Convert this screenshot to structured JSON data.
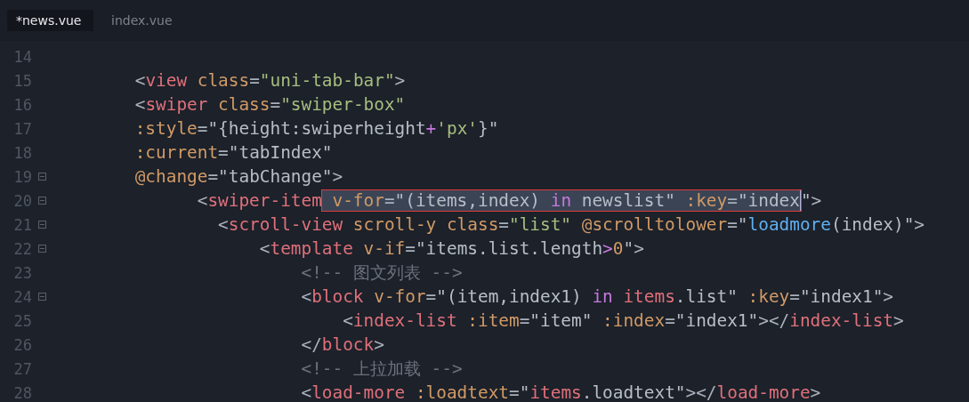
{
  "tabs": [
    {
      "label": "*news.vue",
      "selected": true
    },
    {
      "label": "index.vue",
      "selected": false
    }
  ],
  "lines": [
    {
      "number": "14",
      "fold": false
    },
    {
      "number": "15",
      "fold": false,
      "tokens": [
        {
          "kind": "punct",
          "text": "    <"
        },
        {
          "kind": "tag",
          "text": "view"
        },
        {
          "kind": "attr",
          "text": " class"
        },
        {
          "kind": "punct",
          "text": "="
        },
        {
          "kind": "str",
          "text": "\"uni-tab-bar\""
        },
        {
          "kind": "punct",
          "text": ">"
        }
      ]
    },
    {
      "number": "16",
      "fold": false,
      "tokens": [
        {
          "kind": "punct",
          "text": "    <"
        },
        {
          "kind": "tag",
          "text": "swiper"
        },
        {
          "kind": "attr",
          "text": " class"
        },
        {
          "kind": "punct",
          "text": "="
        },
        {
          "kind": "str",
          "text": "\"swiper-box\""
        }
      ]
    },
    {
      "number": "17",
      "fold": false,
      "tokens": [
        {
          "kind": "attr",
          "text": "    :style"
        },
        {
          "kind": "punct",
          "text": "="
        },
        {
          "kind": "expr",
          "text": "\"{height:swiperheight"
        },
        {
          "kind": "op",
          "text": "+"
        },
        {
          "kind": "str",
          "text": "'px'"
        },
        {
          "kind": "expr",
          "text": "}\""
        }
      ]
    },
    {
      "number": "18",
      "fold": false,
      "tokens": [
        {
          "kind": "attr",
          "text": "    :current"
        },
        {
          "kind": "punct",
          "text": "="
        },
        {
          "kind": "expr",
          "text": "\"tabIndex\""
        }
      ]
    },
    {
      "number": "19",
      "fold": true,
      "tokens": [
        {
          "kind": "attr",
          "text": "    @change"
        },
        {
          "kind": "punct",
          "text": "="
        },
        {
          "kind": "expr",
          "text": "\"tabChange\""
        },
        {
          "kind": "punct",
          "text": ">"
        }
      ]
    },
    {
      "number": "20",
      "fold": true,
      "segments": [
        {
          "selected": false,
          "tokens": [
            {
              "kind": "punct",
              "text": "          <"
            },
            {
              "kind": "tag",
              "text": "swiper-item"
            }
          ]
        },
        {
          "selected": true,
          "tokens": [
            {
              "kind": "attr",
              "text": " v-for"
            },
            {
              "kind": "punct",
              "text": "="
            },
            {
              "kind": "expr",
              "text": "\"(items,index) "
            },
            {
              "kind": "keyword",
              "text": "in"
            },
            {
              "kind": "expr",
              "text": " newslist\" "
            },
            {
              "kind": "attr",
              "text": ":key"
            },
            {
              "kind": "punct",
              "text": "="
            },
            {
              "kind": "expr",
              "text": "\"index"
            }
          ]
        },
        {
          "selected": false,
          "tokens": [
            {
              "kind": "expr",
              "text": "\""
            },
            {
              "kind": "punct",
              "text": ">"
            }
          ]
        }
      ]
    },
    {
      "number": "21",
      "fold": true,
      "tokens": [
        {
          "kind": "punct",
          "text": "            <"
        },
        {
          "kind": "tag",
          "text": "scroll-view"
        },
        {
          "kind": "attr",
          "text": " scroll-y class"
        },
        {
          "kind": "punct",
          "text": "="
        },
        {
          "kind": "str",
          "text": "\"list\""
        },
        {
          "kind": "attr",
          "text": " @scrolltolower"
        },
        {
          "kind": "punct",
          "text": "="
        },
        {
          "kind": "expr",
          "text": "\""
        },
        {
          "kind": "func",
          "text": "loadmore"
        },
        {
          "kind": "expr",
          "text": "(index)\""
        },
        {
          "kind": "punct",
          "text": ">"
        }
      ]
    },
    {
      "number": "22",
      "fold": true,
      "tokens": [
        {
          "kind": "punct",
          "text": "                <"
        },
        {
          "kind": "tag",
          "text": "template"
        },
        {
          "kind": "attr",
          "text": " v-if"
        },
        {
          "kind": "punct",
          "text": "="
        },
        {
          "kind": "expr",
          "text": "\"items.list.length"
        },
        {
          "kind": "op",
          "text": ">"
        },
        {
          "kind": "num",
          "text": "0"
        },
        {
          "kind": "expr",
          "text": "\""
        },
        {
          "kind": "punct",
          "text": ">"
        }
      ]
    },
    {
      "number": "23",
      "fold": false,
      "tokens": [
        {
          "kind": "comment",
          "text": "                    <!-- 图文列表 -->"
        }
      ]
    },
    {
      "number": "24",
      "fold": true,
      "tokens": [
        {
          "kind": "punct",
          "text": "                    <"
        },
        {
          "kind": "tag",
          "text": "block"
        },
        {
          "kind": "attr",
          "text": " v-for"
        },
        {
          "kind": "punct",
          "text": "="
        },
        {
          "kind": "expr",
          "text": "\"(item,index1) "
        },
        {
          "kind": "keyword",
          "text": "in"
        },
        {
          "kind": "var",
          "text": " items"
        },
        {
          "kind": "expr",
          "text": ".list\" "
        },
        {
          "kind": "attr",
          "text": ":key"
        },
        {
          "kind": "punct",
          "text": "="
        },
        {
          "kind": "expr",
          "text": "\"index1\""
        },
        {
          "kind": "punct",
          "text": ">"
        }
      ]
    },
    {
      "number": "25",
      "fold": false,
      "tokens": [
        {
          "kind": "punct",
          "text": "                        <"
        },
        {
          "kind": "tag",
          "text": "index-list"
        },
        {
          "kind": "attr",
          "text": " :item"
        },
        {
          "kind": "punct",
          "text": "="
        },
        {
          "kind": "expr",
          "text": "\"item\" "
        },
        {
          "kind": "attr",
          "text": ":index"
        },
        {
          "kind": "punct",
          "text": "="
        },
        {
          "kind": "expr",
          "text": "\"index1\""
        },
        {
          "kind": "punct",
          "text": "></"
        },
        {
          "kind": "tag",
          "text": "index-list"
        },
        {
          "kind": "punct",
          "text": ">"
        }
      ]
    },
    {
      "number": "26",
      "fold": false,
      "tokens": [
        {
          "kind": "punct",
          "text": "                    </"
        },
        {
          "kind": "tag",
          "text": "block"
        },
        {
          "kind": "punct",
          "text": ">"
        }
      ]
    },
    {
      "number": "27",
      "fold": false,
      "tokens": [
        {
          "kind": "comment",
          "text": "                    <!-- 上拉加载 -->"
        }
      ]
    },
    {
      "number": "28",
      "fold": false,
      "tokens": [
        {
          "kind": "punct",
          "text": "                    <"
        },
        {
          "kind": "tag",
          "text": "load-more"
        },
        {
          "kind": "attr",
          "text": " :loadtext"
        },
        {
          "kind": "punct",
          "text": "="
        },
        {
          "kind": "expr",
          "text": "\""
        },
        {
          "kind": "var",
          "text": "items"
        },
        {
          "kind": "expr",
          "text": ".loadtext\""
        },
        {
          "kind": "punct",
          "text": "></"
        },
        {
          "kind": "tag",
          "text": "load-more"
        },
        {
          "kind": "punct",
          "text": ">"
        }
      ]
    }
  ]
}
